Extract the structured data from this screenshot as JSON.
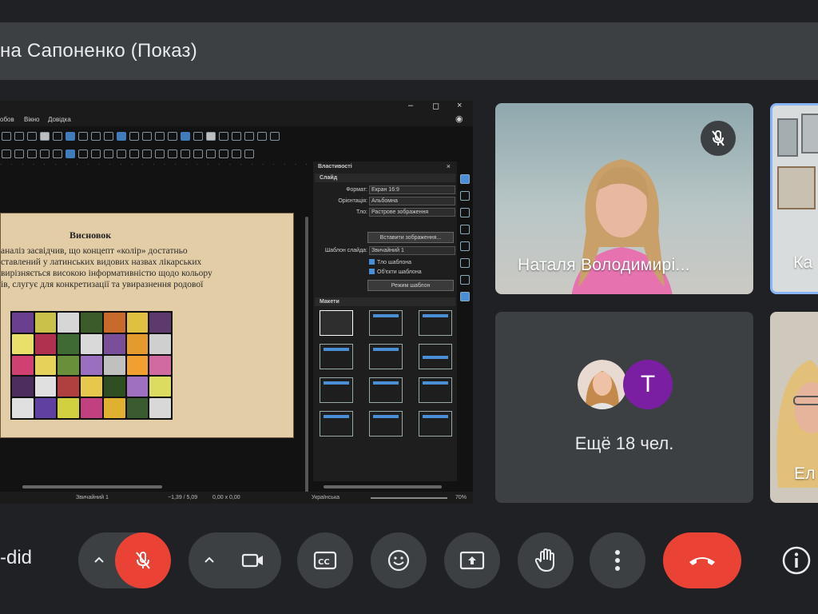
{
  "presenter": {
    "title": "на Сапоненко (Показ)"
  },
  "shared_screen": {
    "menu": [
      "обов",
      "Вікно",
      "Довідка"
    ],
    "slide": {
      "title": "Висновок",
      "body_lines": [
        "аналіз засвідчив, що концепт «колір» достатньо",
        "ставлений у латинських видових назвах лікарських",
        "вирізняється високою інформативністю щодо кольору",
        "ів, слугує для конкретизації та увиразнення родової"
      ]
    },
    "properties": {
      "header": "Властивості",
      "close": "×",
      "section_slide": "Слайд",
      "format_label": "Формат:",
      "format_value": "Екран 16:9",
      "orientation_label": "Орієнтація:",
      "orientation_value": "Альбомна",
      "background_label": "Тло:",
      "background_value": "Растрове зображення",
      "insert_image_btn": "Вставити зображення...",
      "master_label": "Шаблон слайда:",
      "master_value": "Звичайний 1",
      "check_master_bg": "Тло шаблона",
      "check_master_objects": "Об'єкти шаблона",
      "master_view_btn": "Режим шаблон",
      "section_layouts": "Макети"
    },
    "status": {
      "slide_master": "Звичайний 1",
      "position": "−1,39 / 5,09",
      "size": "0,00 x 0,00",
      "language": "Українська",
      "zoom": "70%"
    }
  },
  "participants": [
    {
      "name": "Наталя Володимирі...",
      "muted": true
    },
    {
      "name": "Ка"
    },
    {
      "name": "Ел"
    }
  ],
  "more": {
    "avatar_letter": "T",
    "label": "Ещё 18 чел."
  },
  "controls": {
    "meeting_code": "-did",
    "mic_muted": true,
    "accent_red": "#ea4335",
    "avatar_purple": "#7b1fa2"
  }
}
